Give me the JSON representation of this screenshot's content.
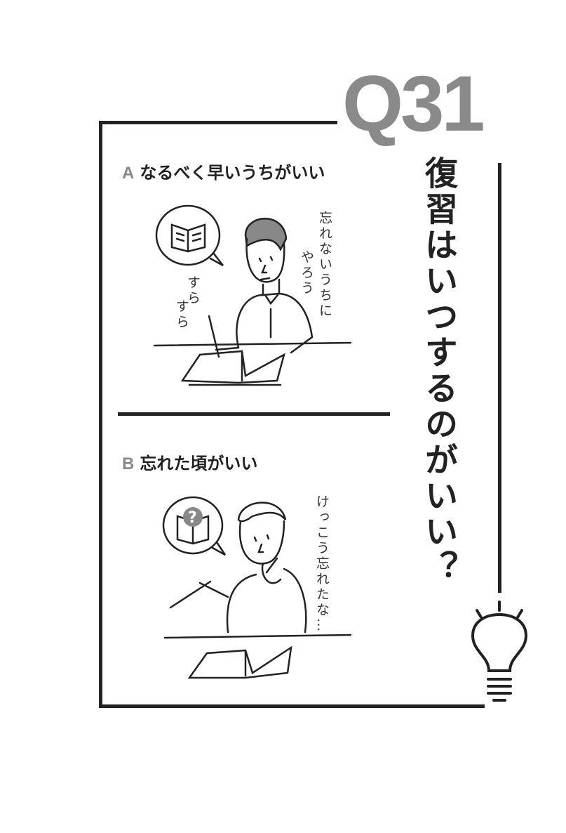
{
  "question": {
    "number": "Q31",
    "title": "復習はいつするのがいい？"
  },
  "options": [
    {
      "letter": "A",
      "text": "なるべく早いうちがいい",
      "speech": [
        "忘れないうちに",
        "やろう"
      ],
      "sfx": [
        "すら",
        "すら"
      ]
    },
    {
      "letter": "B",
      "text": "忘れた頃がいい",
      "speech": [
        "けっこう忘れたな…"
      ]
    }
  ],
  "colors": {
    "accent": "#8a8a8a",
    "ink": "#222222"
  },
  "icons": [
    "lightbulb-icon",
    "book-thought-bubble-icon",
    "question-book-thought-bubble-icon"
  ]
}
